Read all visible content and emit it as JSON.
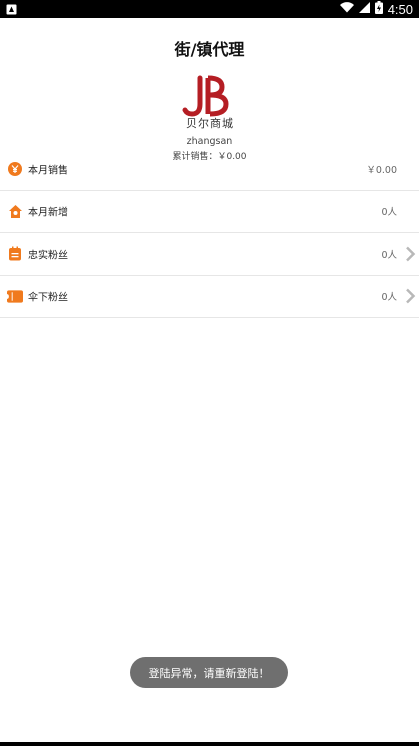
{
  "status_bar": {
    "time": "4:50",
    "icons": [
      "notification-icon",
      "wifi-icon",
      "signal-icon",
      "battery-icon"
    ]
  },
  "header": {
    "title": "街/镇代理"
  },
  "profile": {
    "logo_brand": "贝尔商城",
    "username": "zhangsan",
    "total_sales": "累计销售：￥0.00"
  },
  "list": [
    {
      "icon": "yen-icon",
      "label": "本月销售",
      "value": "￥0.00",
      "has_arrow": false
    },
    {
      "icon": "home-icon",
      "label": "本月新增",
      "value": "0人",
      "has_arrow": false
    },
    {
      "icon": "calendar-icon",
      "label": "忠实粉丝",
      "value": "0人",
      "has_arrow": true
    },
    {
      "icon": "ticket-icon",
      "label": "伞下粉丝",
      "value": "0人",
      "has_arrow": true
    }
  ],
  "toast": {
    "message": "登陆异常，请重新登陆！"
  },
  "colors": {
    "accent": "#f07a1e",
    "logo_red": "#b51e24",
    "divider": "#e6e6e6",
    "toast_bg": "#6f6f6f"
  }
}
